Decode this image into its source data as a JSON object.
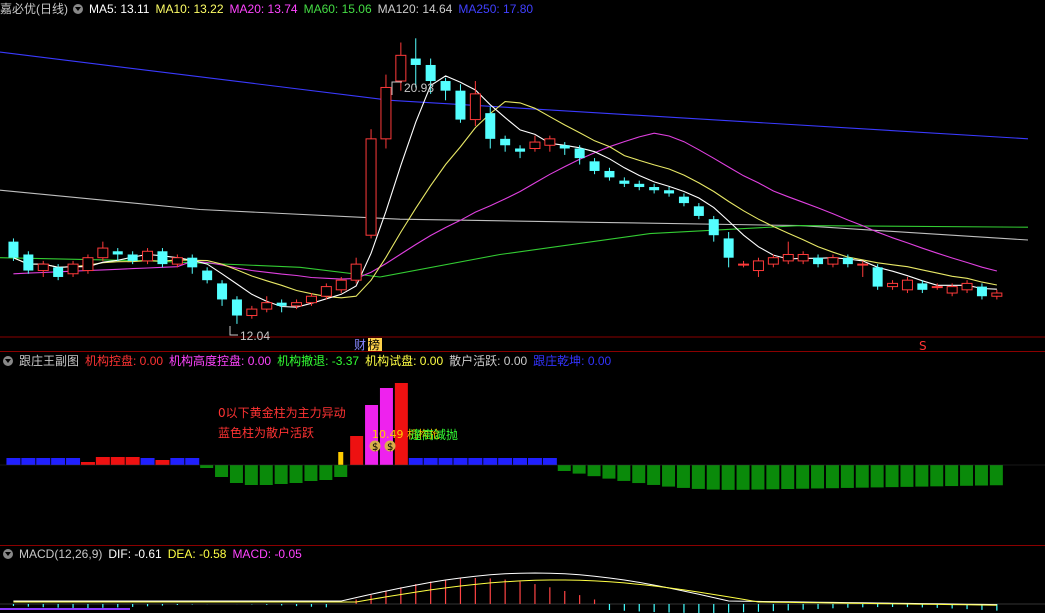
{
  "main": {
    "title": "嘉必优(日线)",
    "ma": [
      {
        "label": "MA5: 13.11",
        "color": "#ffffff"
      },
      {
        "label": "MA10: 13.22",
        "color": "#ffff66"
      },
      {
        "label": "MA20: 13.74",
        "color": "#ff44ff"
      },
      {
        "label": "MA60: 15.06",
        "color": "#44dd44"
      },
      {
        "label": "MA120: 14.64",
        "color": "#cccccc"
      },
      {
        "label": "MA250: 17.80",
        "color": "#4040ff"
      }
    ],
    "high_label": "20.93",
    "low_label": "12.04",
    "tag_cai": "财",
    "tag_bang": "榜",
    "tag_s": "S",
    "candles": [
      [
        14.6,
        14.1,
        14.7,
        14.0
      ],
      [
        14.2,
        13.7,
        14.3,
        13.6
      ],
      [
        13.7,
        13.9,
        14.0,
        13.5
      ],
      [
        13.8,
        13.5,
        13.9,
        13.4
      ],
      [
        13.6,
        13.9,
        14.0,
        13.5
      ],
      [
        13.7,
        14.1,
        14.2,
        13.6
      ],
      [
        14.1,
        14.4,
        14.6,
        14.0
      ],
      [
        14.3,
        14.2,
        14.4,
        14.0
      ],
      [
        14.2,
        14.0,
        14.3,
        13.9
      ],
      [
        14.0,
        14.3,
        14.4,
        13.9
      ],
      [
        14.3,
        13.9,
        14.4,
        13.8
      ],
      [
        13.9,
        14.1,
        14.2,
        13.8
      ],
      [
        14.1,
        13.8,
        14.2,
        13.6
      ],
      [
        13.7,
        13.4,
        13.8,
        13.3
      ],
      [
        13.3,
        12.8,
        13.4,
        12.6
      ],
      [
        12.8,
        12.3,
        12.9,
        12.04
      ],
      [
        12.3,
        12.5,
        12.6,
        12.2
      ],
      [
        12.5,
        12.7,
        12.9,
        12.4
      ],
      [
        12.7,
        12.6,
        12.8,
        12.4
      ],
      [
        12.6,
        12.7,
        12.8,
        12.5
      ],
      [
        12.7,
        12.9,
        13.0,
        12.6
      ],
      [
        12.9,
        13.2,
        13.3,
        12.8
      ],
      [
        13.1,
        13.4,
        13.5,
        13.0
      ],
      [
        13.4,
        13.9,
        14.1,
        13.3
      ],
      [
        14.8,
        17.8,
        18.1,
        14.7
      ],
      [
        17.8,
        19.4,
        19.8,
        17.5
      ],
      [
        19.6,
        20.4,
        20.8,
        19.3
      ],
      [
        20.3,
        20.1,
        20.93,
        19.4
      ],
      [
        20.1,
        19.6,
        20.3,
        19.2
      ],
      [
        19.6,
        19.3,
        19.7,
        19.0
      ],
      [
        19.3,
        18.4,
        19.5,
        18.3
      ],
      [
        18.4,
        19.2,
        19.6,
        18.2
      ],
      [
        18.6,
        17.8,
        18.8,
        17.5
      ],
      [
        17.8,
        17.6,
        17.9,
        17.4
      ],
      [
        17.5,
        17.4,
        17.6,
        17.2
      ],
      [
        17.5,
        17.7,
        17.9,
        17.4
      ],
      [
        17.6,
        17.8,
        17.9,
        17.4
      ],
      [
        17.6,
        17.5,
        17.7,
        17.3
      ],
      [
        17.5,
        17.2,
        17.6,
        17.0
      ],
      [
        17.1,
        16.8,
        17.2,
        16.7
      ],
      [
        16.8,
        16.6,
        16.9,
        16.5
      ],
      [
        16.5,
        16.4,
        16.6,
        16.3
      ],
      [
        16.4,
        16.3,
        16.5,
        16.2
      ],
      [
        16.3,
        16.2,
        16.4,
        16.1
      ],
      [
        16.2,
        16.1,
        16.3,
        16.0
      ],
      [
        16.0,
        15.8,
        16.1,
        15.7
      ],
      [
        15.7,
        15.4,
        15.8,
        15.3
      ],
      [
        15.3,
        14.8,
        15.4,
        14.6
      ],
      [
        14.7,
        14.1,
        14.9,
        13.8
      ],
      [
        13.9,
        13.9,
        14.0,
        13.8
      ],
      [
        13.7,
        14.0,
        14.1,
        13.5
      ],
      [
        13.9,
        14.1,
        14.2,
        13.8
      ],
      [
        14.0,
        14.2,
        14.6,
        13.9
      ],
      [
        14.0,
        14.2,
        14.3,
        13.9
      ],
      [
        14.1,
        13.9,
        14.2,
        13.8
      ],
      [
        13.9,
        14.1,
        14.2,
        13.8
      ],
      [
        14.1,
        13.9,
        14.2,
        13.8
      ],
      [
        13.9,
        13.9,
        14.0,
        13.5
      ],
      [
        13.8,
        13.2,
        13.9,
        13.1
      ],
      [
        13.2,
        13.3,
        13.4,
        13.1
      ],
      [
        13.1,
        13.4,
        13.5,
        13.0
      ],
      [
        13.3,
        13.1,
        13.4,
        13.0
      ],
      [
        13.2,
        13.2,
        13.3,
        13.1
      ],
      [
        13.0,
        13.2,
        13.3,
        12.9
      ],
      [
        13.1,
        13.3,
        13.4,
        13.0
      ],
      [
        13.2,
        12.9,
        13.3,
        12.8
      ],
      [
        12.9,
        13.0,
        13.1,
        12.8
      ]
    ]
  },
  "sub": {
    "title": "跟庄王副图",
    "items": [
      {
        "label": "机构控盘: 0.00",
        "color": "#ff3333"
      },
      {
        "label": "机构高度控盘: 0.00",
        "color": "#ff44ff"
      },
      {
        "label": "机构撤退: -3.37",
        "color": "#33ff33"
      },
      {
        "label": "机构试盘: 0.00",
        "color": "#ffff44"
      },
      {
        "label": "散户活跃: 0.00",
        "color": "#cccccc"
      },
      {
        "label": "跟庄乾坤: 0.00",
        "color": "#3333ff"
      }
    ],
    "note1": "0以下黄金柱为主力异动",
    "note2": "蓝色柱为散户活跃",
    "overlay_text": "10.49 机构抢",
    "overlay_text2": "逢高减抛",
    "badge_s": "$"
  },
  "macd": {
    "title": "MACD(12,26,9)",
    "items": [
      {
        "label": "DIF: -0.61",
        "color": "#ffffff"
      },
      {
        "label": "DEA: -0.58",
        "color": "#ffff44"
      },
      {
        "label": "MACD: -0.05",
        "color": "#ff44ff"
      }
    ]
  }
}
